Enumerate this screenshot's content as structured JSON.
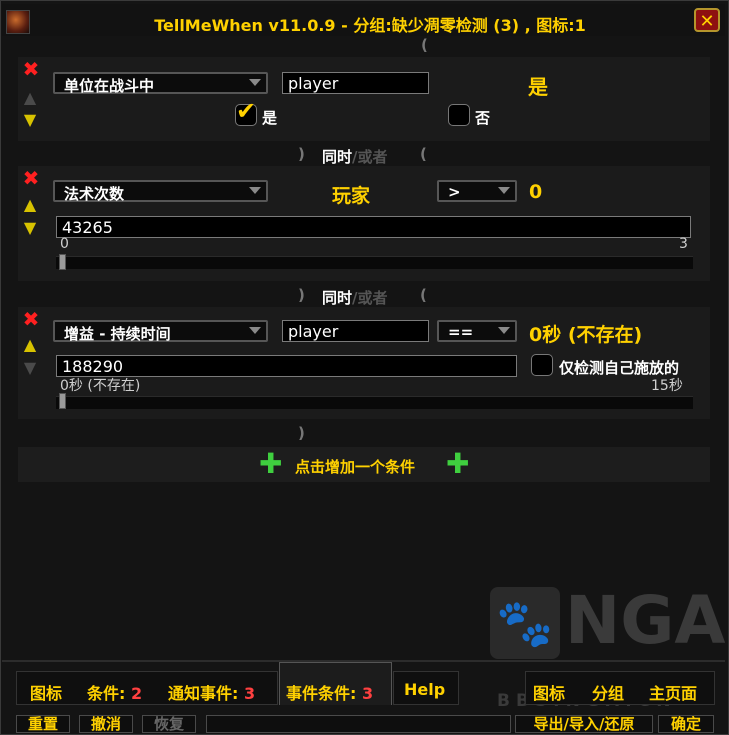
{
  "window": {
    "title": "TellMeWhen v11.0.9  - 分组:缺少凋零检测 (3) , 图标:1",
    "close_label": "✕"
  },
  "conditions": [
    {
      "type": "单位在战斗中",
      "unit": "player",
      "result": "是",
      "check_yes": "是",
      "check_no": "否",
      "check_yes_checked": true,
      "check_no_checked": false
    },
    {
      "connector_and": "同时",
      "connector_sep": "/",
      "connector_or": "或者",
      "type": "法术次数",
      "unit_label": "玩家",
      "operator": ">",
      "value_display": "0",
      "spell": "43265",
      "slider_min": "0",
      "slider_max": "3",
      "slider_value": 0
    },
    {
      "connector_and": "同时",
      "connector_sep": "/",
      "connector_or": "或者",
      "type": "增益 - 持续时间",
      "unit": "player",
      "operator": "==",
      "value_display": "0秒 (不存在)",
      "spell": "188290",
      "only_mine": "仅检测自己施放的",
      "only_mine_checked": false,
      "slider_min": "0秒 (不存在)",
      "slider_max": "15秒",
      "slider_value": 0
    }
  ],
  "parens": {
    "open": "(",
    "close": ")"
  },
  "add_condition": "点击增加一个条件",
  "tabs": {
    "icon": "图标",
    "conditions_label": "条件:",
    "conditions_count": "2",
    "notify_label": "通知事件:",
    "notify_count": "3",
    "event_cond_label": "事件条件:",
    "event_cond_count": "3",
    "help": "Help",
    "right_icon": "图标",
    "right_group": "分组",
    "right_home": "主页面"
  },
  "bottom": {
    "reset": "重置",
    "undo": "撤消",
    "redo": "恢复",
    "export": "导出/导入/还原",
    "ok": "确定"
  },
  "watermark": {
    "logo": "NGA",
    "url": "BBS.NGA.CN"
  }
}
